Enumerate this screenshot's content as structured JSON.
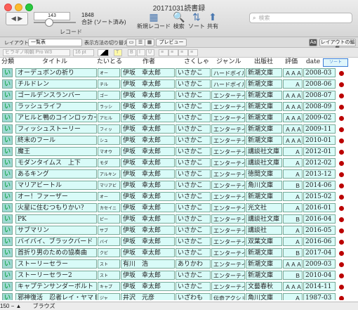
{
  "window": {
    "title": "20171031読書録"
  },
  "toolbar": {
    "record_number": "143",
    "total": "1848",
    "sorted_label": "合計 (ソート済み)",
    "record_label": "レコード",
    "new_record": "新規レコード",
    "find": "検索",
    "sort": "ソート",
    "share": "共有",
    "search_placeholder": "検索"
  },
  "layout_bar": {
    "layout_label": "レイアウト:",
    "layout_value": "一覧表",
    "view_label": "表示方法の切り替え:",
    "preview": "プレビュー",
    "font_mode": "Aa",
    "edit_layout": "レイアウトの編集"
  },
  "format_bar": {
    "font": "ヒラギノ明朝 Pro W3",
    "size": "16 pt"
  },
  "headers": {
    "kind": "分類",
    "title": "タイトル",
    "yomi": "たいとる",
    "author": "作者",
    "sakusha": "さくしゃ",
    "genre": "ジャンル",
    "publisher": "出版社",
    "rating": "評価",
    "date": "date",
    "sort": "ソート"
  },
  "rows": [
    {
      "k": "い",
      "title": "オーデュボンの祈り",
      "yomi": "オー",
      "author": "伊坂　幸太郎",
      "sak": "いさかこ",
      "genre": "ハードボイル",
      "pub": "新潮文庫",
      "rate": "ＡＡＡ",
      "date": "2008-03"
    },
    {
      "k": "い",
      "title": "チルドレン",
      "yomi": "チル",
      "author": "伊坂　幸太郎",
      "sak": "いさかこ",
      "genre": "ハードボイル",
      "pub": "新潮文庫",
      "rate": "Ａ",
      "date": "2008-06"
    },
    {
      "k": "い",
      "title": "ゴールデンスランバー",
      "yomi": "ゴー",
      "author": "伊坂　幸太郎",
      "sak": "いさかこ",
      "genre": "エンターテイ",
      "pub": "新潮文庫",
      "rate": "ＡＡＡ",
      "date": "2008-07"
    },
    {
      "k": "い",
      "title": "ラッシュライフ",
      "yomi": "ラッシ",
      "author": "伊坂　幸太郎",
      "sak": "いさかこ",
      "genre": "エンターテイ",
      "pub": "新潮文庫",
      "rate": "ＡＡＡ",
      "date": "2008-09"
    },
    {
      "k": "い",
      "title": "アヒルと鴨のコインロッカー",
      "yomi": "アヒル",
      "author": "伊坂　幸太郎",
      "sak": "いさかこ",
      "genre": "エンターテイ",
      "pub": "新潮文庫",
      "rate": "ＡＡＡ",
      "date": "2009-02"
    },
    {
      "k": "い",
      "title": "フィッシュストーリー",
      "yomi": "フィッ",
      "author": "伊坂　幸太郎",
      "sak": "いさかこ",
      "genre": "エンターテイ",
      "pub": "新潮文庫",
      "rate": "ＡＡＡ",
      "date": "2009-11"
    },
    {
      "k": "い",
      "title": "終末のフール",
      "yomi": "シュ",
      "author": "伊坂　幸太郎",
      "sak": "いさかこ",
      "genre": "エンターテイ",
      "pub": "新潮文庫",
      "rate": "ＡＡＡ",
      "date": "2010-01"
    },
    {
      "k": "い",
      "title": "魔王",
      "yomi": "マオウ",
      "author": "伊坂　幸太郎",
      "sak": "いさかこ",
      "genre": "エンターテイ",
      "pub": "講談社文庫",
      "rate": "Ａ",
      "date": "2012-01"
    },
    {
      "k": "い",
      "title": "モダンタイムス　上下",
      "yomi": "モダ",
      "author": "伊坂　幸太郎",
      "sak": "いさかこ",
      "genre": "エンターテイ",
      "pub": "講談社文庫",
      "rate": "Ａ",
      "date": "2012-02"
    },
    {
      "k": "い",
      "title": "あるキング",
      "yomi": "アルキン",
      "author": "伊坂　幸太郎",
      "sak": "いさかこ",
      "genre": "エンターテイ",
      "pub": "徳間文庫",
      "rate": "Ａ",
      "date": "2013-12"
    },
    {
      "k": "い",
      "title": "マリアビートル",
      "yomi": "マリアビ",
      "author": "伊坂　幸太郎",
      "sak": "いさかこ",
      "genre": "エンターテイ",
      "pub": "角川文庫",
      "rate": "Ｂ",
      "date": "2014-06"
    },
    {
      "k": "い",
      "title": "オー！ファーザー",
      "yomi": "オー",
      "author": "伊坂　幸太郎",
      "sak": "いさかこ",
      "genre": "エンターテイ",
      "pub": "新潮文庫",
      "rate": "Ａ",
      "date": "2015-02"
    },
    {
      "k": "い",
      "title": "火星に住むつもりかい？",
      "yomi": "カセイニ",
      "author": "伊坂　幸太郎",
      "sak": "いさかこ",
      "genre": "エンターテイ",
      "pub": "光文社",
      "rate": "Ａ",
      "date": "2016-01"
    },
    {
      "k": "い",
      "title": "PK",
      "yomi": "ピー",
      "author": "伊坂　幸太郎",
      "sak": "いさかこ",
      "genre": "エンターテイ",
      "pub": "講談社文庫",
      "rate": "Ｂ",
      "date": "2016-04"
    },
    {
      "k": "い",
      "title": "サブマリン",
      "yomi": "サブ",
      "author": "伊坂　幸太郎",
      "sak": "いさかこ",
      "genre": "エンターテイ",
      "pub": "講談社",
      "rate": "Ａ",
      "date": "2016-05"
    },
    {
      "k": "い",
      "title": "バイバイ、ブラックバード",
      "yomi": "バイ",
      "author": "伊坂　幸太郎",
      "sak": "いさかこ",
      "genre": "エンターテイ",
      "pub": "双葉文庫",
      "rate": "Ａ",
      "date": "2016-06"
    },
    {
      "k": "い",
      "title": "首折り男のための協奏曲",
      "yomi": "クビ",
      "author": "伊坂　幸太郎",
      "sak": "いさかこ",
      "genre": "エンターテイ",
      "pub": "新潮文庫",
      "rate": "Ｂ",
      "date": "2017-04"
    },
    {
      "k": "い",
      "title": "ストーリーセラー",
      "yomi": "スト",
      "author": "有川　浩",
      "sak": "ありかわ",
      "genre": "エンターテイ",
      "pub": "新潮文庫",
      "rate": "ＡＡＡ",
      "date": "2009-03"
    },
    {
      "k": "い",
      "title": "ストーリーセラー2",
      "yomi": "スト",
      "author": "伊坂　幸太郎",
      "sak": "いさかこ",
      "genre": "エンターテイ",
      "pub": "新潮文庫",
      "rate": "Ｂ",
      "date": "2010-04"
    },
    {
      "k": "い",
      "title": "キャプテンサンダーボルト",
      "yomi": "キャプ",
      "author": "伊坂　幸太郎",
      "sak": "いさかこ",
      "genre": "エンターテイ",
      "pub": "文藝春秋",
      "rate": "ＡＡＡ",
      "date": "2014-11"
    },
    {
      "k": "い",
      "title": "邪神復活　忍者レイ・ヤマト",
      "yomi": "ジャ",
      "author": "井沢　元彦",
      "sak": "いざわも",
      "genre": "伝奇アクショ",
      "pub": "角川文庫",
      "rate": "Ａ",
      "date": "1987-03"
    }
  ],
  "status": {
    "zoom": "150",
    "mode": "ブラウズ"
  }
}
